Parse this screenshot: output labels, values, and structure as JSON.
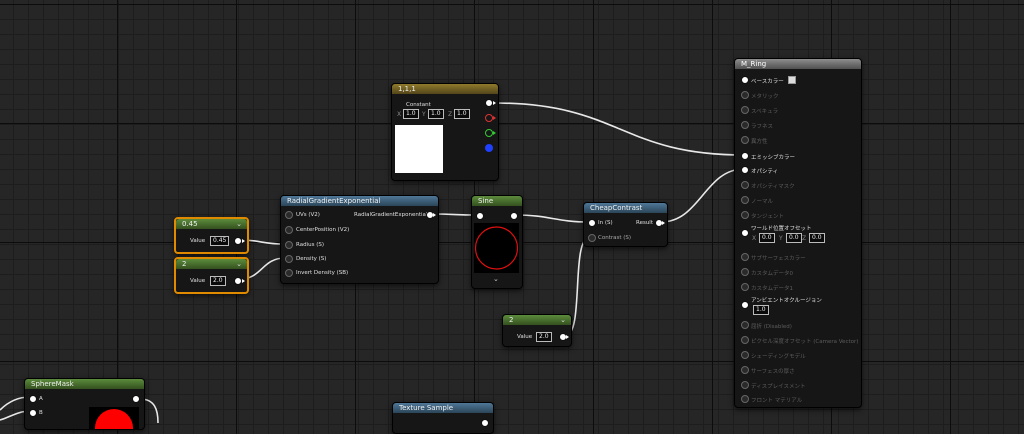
{
  "nodes": {
    "vector": {
      "title": "1,1,1",
      "constant_label": "Constant",
      "x_label": "X",
      "x_value": "1.0",
      "y_label": "Y",
      "y_value": "1.0",
      "z_label": "Z",
      "z_value": "1.0"
    },
    "radial": {
      "title": "RadialGradientExponential",
      "inputs": [
        "UVs (V2)",
        "CenterPosition (V2)",
        "Radius (S)",
        "Density (S)",
        "Invert Density (SB)"
      ],
      "output": "RadialGradientExponential"
    },
    "param045": {
      "title": "0.45",
      "value_label": "Value",
      "value": "0.45"
    },
    "param2a": {
      "title": "2",
      "value_label": "Value",
      "value": "2.0"
    },
    "sine": {
      "title": "Sine"
    },
    "contrast": {
      "title": "CheapContrast",
      "in_label": "In (S)",
      "contrast_label": "Contrast (S)",
      "out_label": "Result"
    },
    "param2b": {
      "title": "2",
      "value_label": "Value",
      "value": "2.0"
    },
    "sphere": {
      "title": "SphereMask",
      "a_label": "A",
      "b_label": "B"
    },
    "texture": {
      "title": "Texture Sample"
    },
    "material": {
      "title": "M_Ring",
      "pins": [
        "ベースカラー",
        "メタリック",
        "スペキュラ",
        "ラフネス",
        "異方性",
        "エミッシブカラー",
        "オパシティ",
        "オパシティマスク",
        "ノーマル",
        "タンジェント",
        "ワールド位置オフセット",
        "サブサーフェスカラー",
        "カスタムデータ0",
        "カスタムデータ1",
        "アンビエントオクルージョン",
        "屈折 (Disabled)",
        "ピクセル深度オフセット (Camera Vector)",
        "シェーディングモデル",
        "サーフェスの厚さ",
        "ディスプレイスメント",
        "フロント マテリアル"
      ],
      "wpo_x": "0.0",
      "wpo_y": "0.0",
      "wpo_z": "0.0",
      "ao_value": "1.0"
    }
  }
}
